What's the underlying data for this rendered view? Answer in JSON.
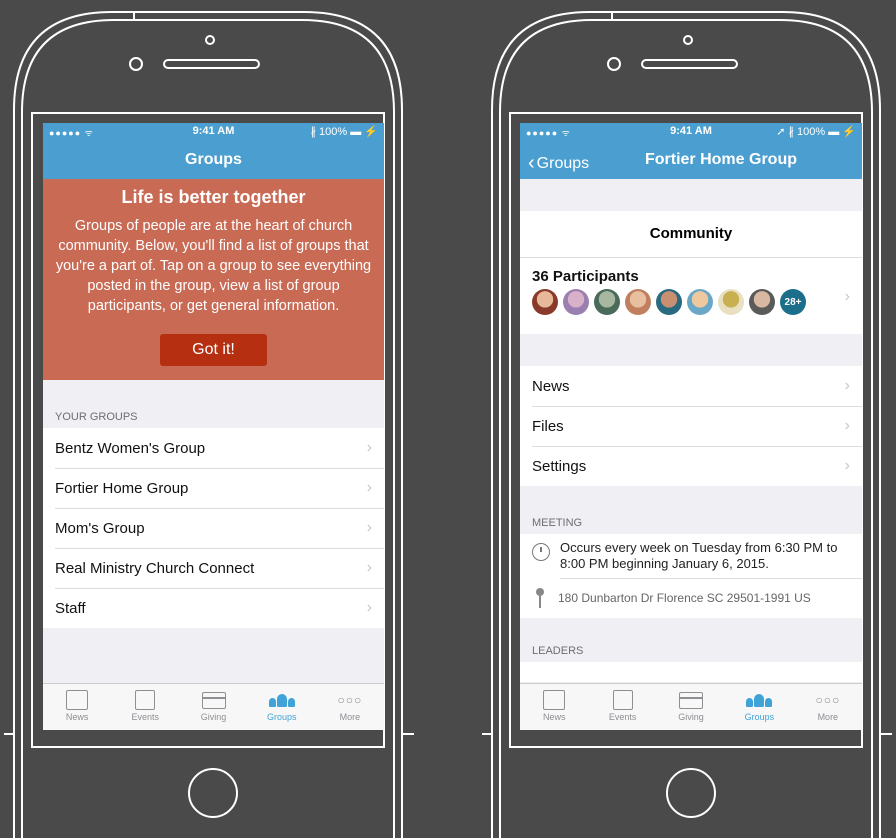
{
  "status": {
    "signal": "●●●●● ᯤ",
    "time": "9:41 AM",
    "right_left": "∦ 100% ▬ ⚡",
    "right_right": "➚ ∦ 100% ▬ ⚡"
  },
  "left": {
    "title": "Groups",
    "banner": {
      "heading": "Life is better together",
      "body": "Groups of people are at the heart of church community. Below, you'll find a list of groups that you're a part of. Tap on a group to see everything posted in the group, view a list of group participants, or get general information.",
      "button": "Got it!"
    },
    "section_header": "YOUR GROUPS",
    "groups": [
      "Bentz Women's Group",
      "Fortier Home Group",
      "Mom's Group",
      "Real Ministry Church Connect",
      "Staff"
    ]
  },
  "right": {
    "back": "Groups",
    "title": "Fortier Home Group",
    "community": "Community",
    "participants_label": "36 Participants",
    "more_count": "28+",
    "menu": [
      "News",
      "Files",
      "Settings"
    ],
    "meeting_header": "MEETING",
    "meeting_text": "Occurs every week on Tuesday from 6:30 PM to 8:00 PM beginning January 6, 2015.",
    "address": "180 Dunbarton Dr Florence SC 29501-1991 US",
    "leaders_header": "LEADERS"
  },
  "tabs": [
    {
      "label": "News",
      "icon": "newspaper-icon"
    },
    {
      "label": "Events",
      "icon": "calendar-icon"
    },
    {
      "label": "Giving",
      "icon": "credit-card-icon"
    },
    {
      "label": "Groups",
      "icon": "people-icon"
    },
    {
      "label": "More",
      "icon": "more-dots-icon"
    }
  ],
  "colors": {
    "accent": "#4a9fd0",
    "banner": "#c96a55",
    "button": "#b52f10",
    "active_tab": "#3fa3d8"
  }
}
